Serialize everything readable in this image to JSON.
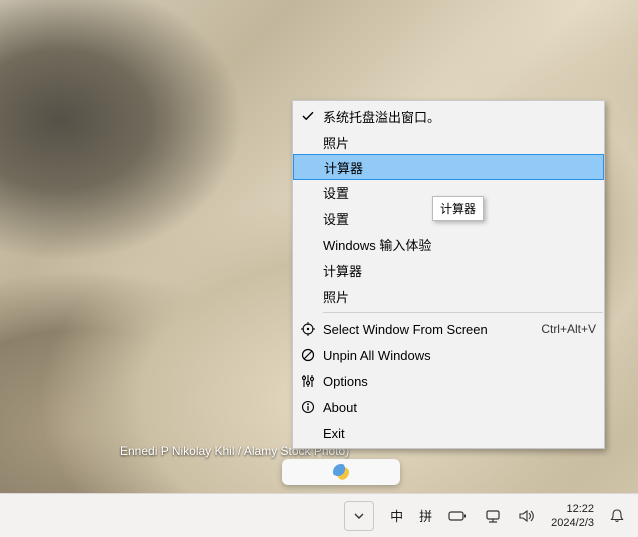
{
  "desktop": {
    "caption": "Ennedi P            Nikolay Khil / Alamy Stock Photo)"
  },
  "context_menu": {
    "items": [
      {
        "label": "系统托盘溢出窗口。",
        "checked": true
      },
      {
        "label": "照片"
      },
      {
        "label": "计算器",
        "highlighted": true
      },
      {
        "label": "设置"
      },
      {
        "label": "设置"
      },
      {
        "label": "Windows 输入体验"
      },
      {
        "label": "计算器"
      },
      {
        "label": "照片"
      }
    ],
    "actions": [
      {
        "icon": "target",
        "label": "Select Window From Screen",
        "shortcut": "Ctrl+Alt+V"
      },
      {
        "icon": "no",
        "label": "Unpin All Windows"
      },
      {
        "icon": "sliders",
        "label": "Options"
      },
      {
        "icon": "info",
        "label": "About"
      },
      {
        "icon": "none",
        "label": "Exit"
      }
    ]
  },
  "tooltip": {
    "text": "计算器"
  },
  "taskbar": {
    "ime_lang": "中",
    "ime_mode": "拼",
    "time": "12:22",
    "date": "2024/2/3"
  }
}
